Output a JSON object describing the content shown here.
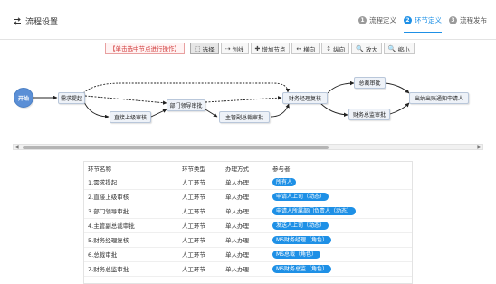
{
  "header": {
    "title": "流程设置",
    "steps": [
      {
        "num": "1",
        "label": "流程定义"
      },
      {
        "num": "2",
        "label": "环节定义"
      },
      {
        "num": "3",
        "label": "流程发布"
      }
    ],
    "active_step": 1
  },
  "toolbar": {
    "hint": "【单击选中节点进行操作】",
    "buttons": [
      {
        "icon": "cursor-icon",
        "glyph": "⬚",
        "label": "选择"
      },
      {
        "icon": "line-icon",
        "glyph": "⇢",
        "label": "划线"
      },
      {
        "icon": "plus-icon",
        "glyph": "✚",
        "label": "增加节点"
      },
      {
        "icon": "horizontal-icon",
        "glyph": "↔",
        "label": "横向"
      },
      {
        "icon": "vertical-icon",
        "glyph": "↕",
        "label": "纵向"
      },
      {
        "icon": "zoom-in-icon",
        "glyph": "🔍",
        "label": "放大"
      },
      {
        "icon": "zoom-out-icon",
        "glyph": "🔍",
        "label": "缩小"
      }
    ]
  },
  "flow": {
    "nodes": [
      {
        "id": "n0",
        "label": "开始"
      },
      {
        "id": "n1",
        "label": "需求提起"
      },
      {
        "id": "n2",
        "label": "直接上级审核"
      },
      {
        "id": "n3",
        "label": "部门领导审批"
      },
      {
        "id": "n4",
        "label": "主管副总裁审批"
      },
      {
        "id": "n5",
        "label": "财务经理复核"
      },
      {
        "id": "n6",
        "label": "总裁审批"
      },
      {
        "id": "n7",
        "label": "财务总监审批"
      },
      {
        "id": "n8",
        "label": "出纳出账通知申请人"
      }
    ]
  },
  "table": {
    "headers": [
      "环节名称",
      "环节类型",
      "办理方式",
      "参与者"
    ],
    "rows": [
      {
        "name": "1.需求提起",
        "type": "人工环节",
        "mode": "单人办理",
        "participant": "所有人"
      },
      {
        "name": "2.直接上级审核",
        "type": "人工环节",
        "mode": "单人办理",
        "participant": "申请人上司（动态）"
      },
      {
        "name": "3.部门领导审批",
        "type": "人工环节",
        "mode": "单人办理",
        "participant": "申请人所属部门负责人（动态）"
      },
      {
        "name": "4.主管副总裁审批",
        "type": "人工环节",
        "mode": "单人办理",
        "participant": "发送人上司（动态）"
      },
      {
        "name": "5.财务经理复核",
        "type": "人工环节",
        "mode": "单人办理",
        "participant": "MS财务经理（角色）"
      },
      {
        "name": "6.总裁审批",
        "type": "人工环节",
        "mode": "单人办理",
        "participant": "MS总裁（角色）"
      },
      {
        "name": "7.财务总监审批",
        "type": "人工环节",
        "mode": "单人办理",
        "participant": "MS财务总监（角色）"
      }
    ]
  },
  "colors": {
    "accent": "#1e90e6",
    "start_node": "#5b8fd6",
    "hint_text": "#d23b3b"
  }
}
